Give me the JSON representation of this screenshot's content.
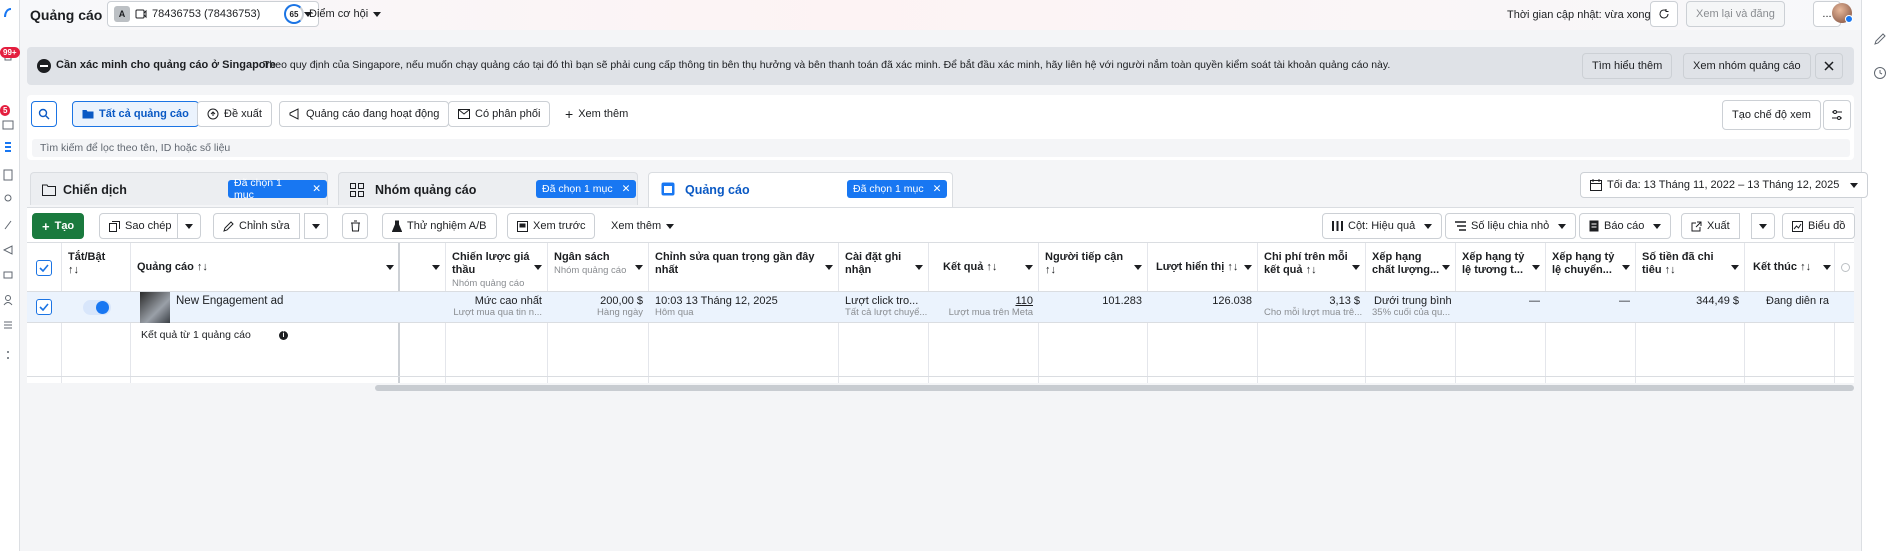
{
  "top": {
    "title": "Quảng cáo",
    "account_initial": "A",
    "account_label": "78436753 (78436753)",
    "opportunity_score": "65",
    "opportunity_label": "Điểm cơ hội",
    "last_updated": "Thời gian cập nhật: vừa xong",
    "review_publish": "Xem lại và đăng",
    "more": "..."
  },
  "sidebar": {
    "badge_messages": "99+",
    "badge_alerts": "5"
  },
  "banner": {
    "title": "Cần xác minh cho quảng cáo ở Singapore",
    "text": "Theo quy định của Singapore, nếu muốn chạy quảng cáo tại đó thì bạn sẽ phải cung cấp thông tin bên thụ hưởng và bên thanh toán đã xác minh. Để bắt đầu xác minh, hãy liên hệ với người nắm toàn quyền kiểm soát tài khoản quảng cáo này.",
    "learn_more": "Tìm hiểu thêm",
    "view_ad_sets": "Xem nhóm quảng cáo"
  },
  "filters": {
    "all_ads": "Tất cả quảng cáo",
    "suggested": "Đề xuất",
    "active_ads": "Quảng cáo đang hoạt động",
    "delivery": "Có phân phối",
    "see_more": "Xem thêm",
    "create_view": "Tạo chế độ xem",
    "search_placeholder": "Tìm kiếm để lọc theo tên, ID hoặc số liệu"
  },
  "levels": {
    "campaigns": "Chiến dịch",
    "ad_sets": "Nhóm quảng cáo",
    "ads": "Quảng cáo",
    "selected_chip": "Đã chọn 1 mục",
    "date_range": "Tối đa: 13 Tháng 11, 2022 – 13 Tháng 12, 2025"
  },
  "toolbar": {
    "create": "Tạo",
    "duplicate": "Sao chép",
    "edit": "Chỉnh sửa",
    "ab_test": "Thử nghiệm A/B",
    "preview": "Xem trước",
    "more": "Xem thêm",
    "columns": "Cột: Hiệu quả",
    "breakdown": "Số liệu chia nhỏ",
    "reports": "Báo cáo",
    "export": "Xuất",
    "charts": "Biểu đồ"
  },
  "table": {
    "headers": {
      "toggle": "Tắt/Bật",
      "ad": "Quảng cáo",
      "bid_strategy": "Chiến lược giá thầu",
      "budget": "Ngân sách",
      "last_edit": "Chỉnh sửa quan trọng gần đây nhất",
      "attribution": "Cài đặt ghi nhận",
      "results": "Kết quả",
      "reach": "Người tiếp cận",
      "impressions": "Lượt hiển thị",
      "cost_per_result": "Chi phí trên mỗi kết quả",
      "quality_ranking": "Xếp hạng chất lượng...",
      "engagement_ranking": "Xếp hạng tỷ lệ tương t...",
      "conversion_ranking": "Xếp hạng tỷ lệ chuyển...",
      "amount_spent": "Số tiền đã chi tiêu",
      "ends": "Kết thúc"
    },
    "sort_icon": "↑↓",
    "row": {
      "name": "New Engagement ad",
      "bid_strategy": "Mức cao nhất",
      "bid_strategy_sub": "Lượt mua qua tin n...",
      "budget": "200,00 $",
      "budget_sub": "Hàng ngày",
      "last_edit": "10:03 13 Tháng 12, 2025",
      "last_edit_sub": "Hôm qua",
      "attribution": "Lượt click tro...",
      "attribution_sub": "Tất cả lượt chuyể...",
      "results": "110",
      "results_sub": "Lượt mua trên Meta",
      "reach": "101.283",
      "impressions": "126.038",
      "cost_per_result": "3,13 $",
      "cost_per_result_sub": "Cho mỗi lượt mua trê...",
      "quality_ranking": "Dưới trung bình",
      "quality_ranking_sub": "35% cuối của qu...",
      "engagement_ranking": "—",
      "conversion_ranking": "—",
      "amount_spent": "344,49 $",
      "ends": "Đang diễn ra"
    },
    "sub_bid": "Nhóm quảng cáo",
    "sub_budget": "Nhóm quảng cáo",
    "summary": "Kết quả từ 1 quảng cáo"
  },
  "colors": {
    "accent": "#1877f2",
    "create": "#1a7a3e",
    "banner": "#dfe2e7"
  }
}
